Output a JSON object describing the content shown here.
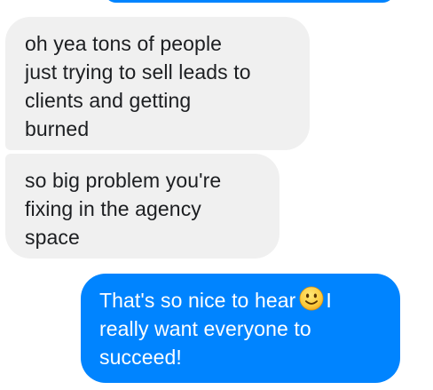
{
  "colors": {
    "incoming_bubble": "#f0f0f0",
    "incoming_text": "#1c1e21",
    "outgoing_bubble": "#0084ff",
    "outgoing_text": "#ffffff"
  },
  "messages": [
    {
      "direction": "incoming",
      "lines": [
        "oh yea tons of people",
        "just trying to sell leads to",
        "clients and getting",
        "burned"
      ]
    },
    {
      "direction": "incoming",
      "lines": [
        "so big problem you're",
        "fixing in the agency",
        "space"
      ]
    },
    {
      "direction": "outgoing",
      "lines": [
        "That's so nice to hear",
        "I",
        "really want everyone to",
        "succeed!"
      ],
      "emoji": "slightly-smiling-face-icon"
    }
  ]
}
